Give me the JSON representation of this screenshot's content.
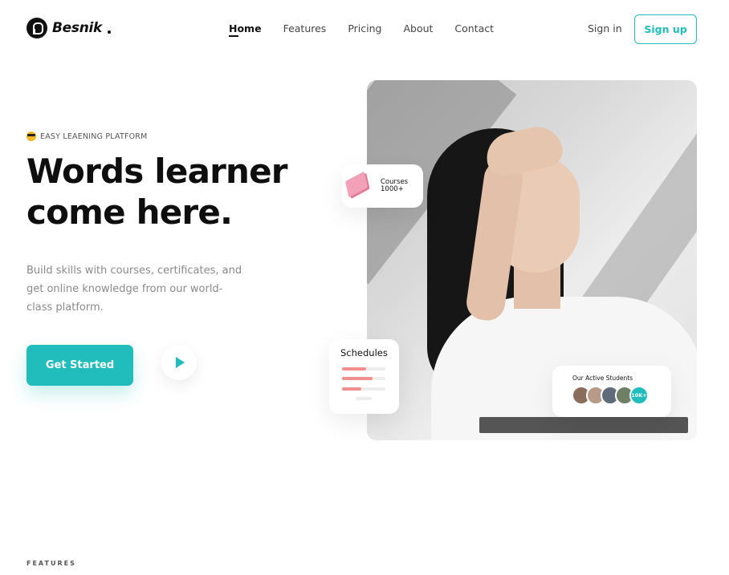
{
  "brand": {
    "name": "Besnik"
  },
  "nav": {
    "items": [
      {
        "label": "Home",
        "active": true
      },
      {
        "label": "Features",
        "active": false
      },
      {
        "label": "Pricing",
        "active": false
      },
      {
        "label": "About",
        "active": false
      },
      {
        "label": "Contact",
        "active": false
      }
    ],
    "signin_label": "Sign in",
    "signup_label": "Sign up"
  },
  "hero": {
    "eyebrow": "EASY LEAENING PLATFORM",
    "title_line1": "Words learner",
    "title_line2": "come here.",
    "description": "Build skills with courses, certificates, and get online knowledge from our world-class platform.",
    "cta_label": "Get Started"
  },
  "cards": {
    "courses": {
      "label": "Courses",
      "value": "1000+"
    },
    "schedules": {
      "title": "Schedules",
      "progress": [
        0.55,
        0.7,
        0.45
      ]
    },
    "students": {
      "title": "Our Active Students",
      "count": "10K+"
    }
  },
  "section": {
    "features_label": "FEATURES"
  },
  "colors": {
    "accent": "#21bcbc",
    "text": "#0e0e0e",
    "muted": "#8a8a8a",
    "schedule_bar": "#f28e8e"
  }
}
